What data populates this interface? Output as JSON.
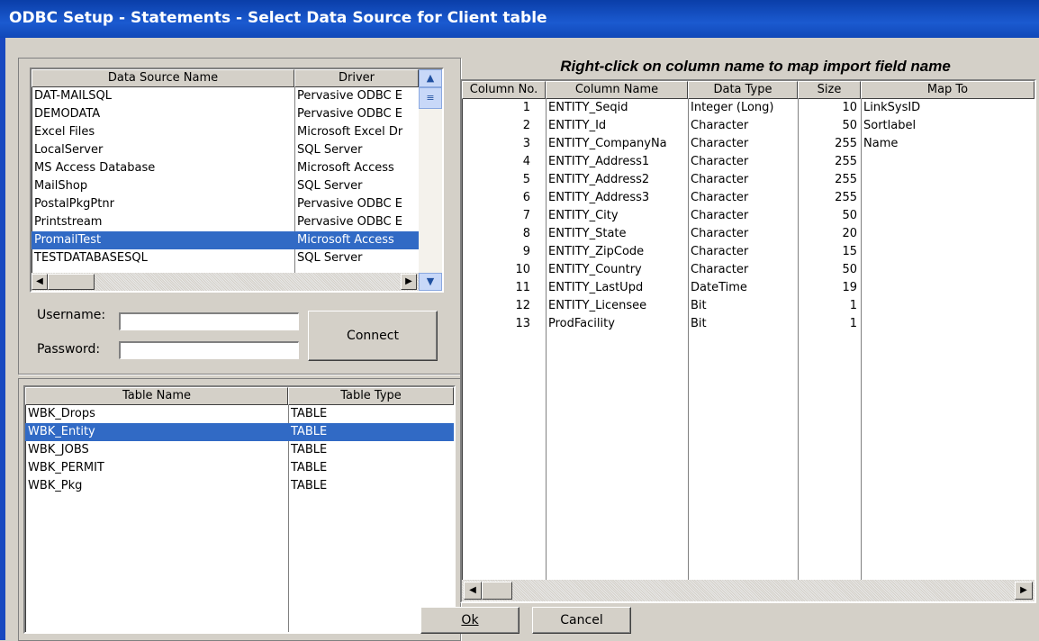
{
  "window": {
    "title": "ODBC Setup - Statements - Select Data Source for Client table"
  },
  "datasources": {
    "headers": [
      "Data Source Name",
      "Driver"
    ],
    "rows": [
      [
        "DAT-MAILSQL",
        "Pervasive ODBC E"
      ],
      [
        "DEMODATA",
        "Pervasive ODBC E"
      ],
      [
        "Excel Files",
        "Microsoft Excel Dr"
      ],
      [
        "LocalServer",
        "SQL Server"
      ],
      [
        "MS Access Database",
        "Microsoft Access"
      ],
      [
        "MailShop",
        "SQL Server"
      ],
      [
        "PostalPkgPtnr",
        "Pervasive ODBC E"
      ],
      [
        "Printstream",
        "Pervasive ODBC E"
      ],
      [
        "PromailTest",
        "Microsoft Access"
      ],
      [
        "TESTDATABASESQL",
        "SQL Server"
      ]
    ],
    "selected_index": 8
  },
  "login": {
    "username_label": "Username:",
    "password_label": "Password:",
    "username_value": "",
    "password_value": "",
    "connect_label": "Connect"
  },
  "tables": {
    "headers": [
      "Table Name",
      "Table Type"
    ],
    "rows": [
      [
        "WBK_Drops",
        "TABLE"
      ],
      [
        "WBK_Entity",
        "TABLE"
      ],
      [
        "WBK_JOBS",
        "TABLE"
      ],
      [
        "WBK_PERMIT",
        "TABLE"
      ],
      [
        "WBK_Pkg",
        "TABLE"
      ]
    ],
    "selected_index": 1
  },
  "columns": {
    "instruction": "Right-click on column name to map import field name",
    "headers": [
      "Column No.",
      "Column Name",
      "Data Type",
      "Size",
      "Map To"
    ],
    "rows": [
      [
        "1",
        "ENTITY_Seqid",
        "Integer (Long)",
        "10",
        "LinkSysID"
      ],
      [
        "2",
        "ENTITY_Id",
        "Character",
        "50",
        "Sortlabel"
      ],
      [
        "3",
        "ENTITY_CompanyNa",
        "Character",
        "255",
        "Name"
      ],
      [
        "4",
        "ENTITY_Address1",
        "Character",
        "255",
        ""
      ],
      [
        "5",
        "ENTITY_Address2",
        "Character",
        "255",
        ""
      ],
      [
        "6",
        "ENTITY_Address3",
        "Character",
        "255",
        ""
      ],
      [
        "7",
        "ENTITY_City",
        "Character",
        "50",
        ""
      ],
      [
        "8",
        "ENTITY_State",
        "Character",
        "20",
        ""
      ],
      [
        "9",
        "ENTITY_ZipCode",
        "Character",
        "15",
        ""
      ],
      [
        "10",
        "ENTITY_Country",
        "Character",
        "50",
        ""
      ],
      [
        "11",
        "ENTITY_LastUpd",
        "DateTime",
        "19",
        ""
      ],
      [
        "12",
        "ENTITY_Licensee",
        "Bit",
        "1",
        ""
      ],
      [
        "13",
        "ProdFacility",
        "Bit",
        "1",
        ""
      ]
    ]
  },
  "buttons": {
    "ok_label": "Ok",
    "cancel_label": "Cancel"
  }
}
